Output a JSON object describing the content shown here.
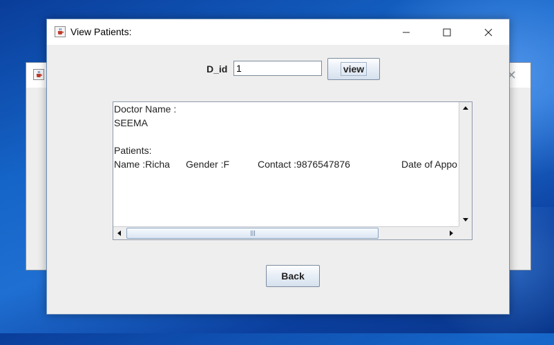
{
  "window": {
    "title": "View Patients:"
  },
  "form": {
    "did_label": "D_id",
    "did_value": "1",
    "view_label": "view",
    "back_label": "Back"
  },
  "output": {
    "line1": "Doctor Name :",
    "line2": "SEEMA",
    "line3": "",
    "line4": "Patients:",
    "patient_name": "Name :Richa",
    "patient_gender": "Gender :F",
    "patient_contact": "Contact :9876547876",
    "patient_date": "Date of Appo"
  },
  "icons": {
    "app_icon": "java-coffee-icon",
    "minimize": "minimize-icon",
    "maximize": "maximize-icon",
    "close": "close-icon"
  }
}
